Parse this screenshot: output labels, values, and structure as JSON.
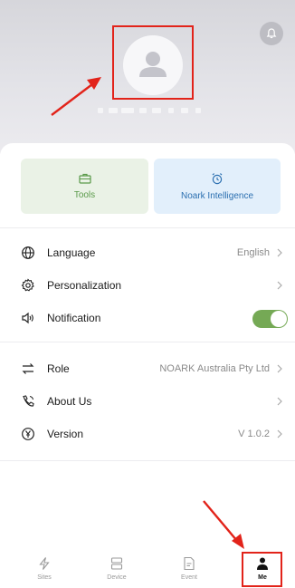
{
  "header": {
    "username_masked": ""
  },
  "cards": [
    {
      "label": "Tools",
      "icon": "briefcase-icon"
    },
    {
      "label": "Noark Intelligence",
      "icon": "alarm-clock-icon"
    }
  ],
  "settings_group_1": [
    {
      "label": "Language",
      "value": "English",
      "icon": "globe-icon"
    },
    {
      "label": "Personalization",
      "value": "",
      "icon": "gear-icon"
    },
    {
      "label": "Notification",
      "value": "",
      "icon": "speaker-icon",
      "toggle_on": true
    }
  ],
  "settings_group_2": [
    {
      "label": "Role",
      "value": "NOARK Australia Pty Ltd",
      "icon": "swap-icon"
    },
    {
      "label": "About Us",
      "value": "",
      "icon": "phone-icon"
    },
    {
      "label": "Version",
      "value": "V 1.0.2",
      "icon": "yen-circle-icon"
    }
  ],
  "tabbar": {
    "tabs": [
      {
        "label": "Sites",
        "icon": "lightning-icon"
      },
      {
        "label": "Device",
        "icon": "device-icon"
      },
      {
        "label": "Event",
        "icon": "document-icon"
      },
      {
        "label": "Me",
        "icon": "person-icon",
        "active": true
      }
    ]
  },
  "colors": {
    "accent_green": "#75a955",
    "annotation_red": "#e2231a",
    "noark_blue": "#2b6fb0"
  }
}
